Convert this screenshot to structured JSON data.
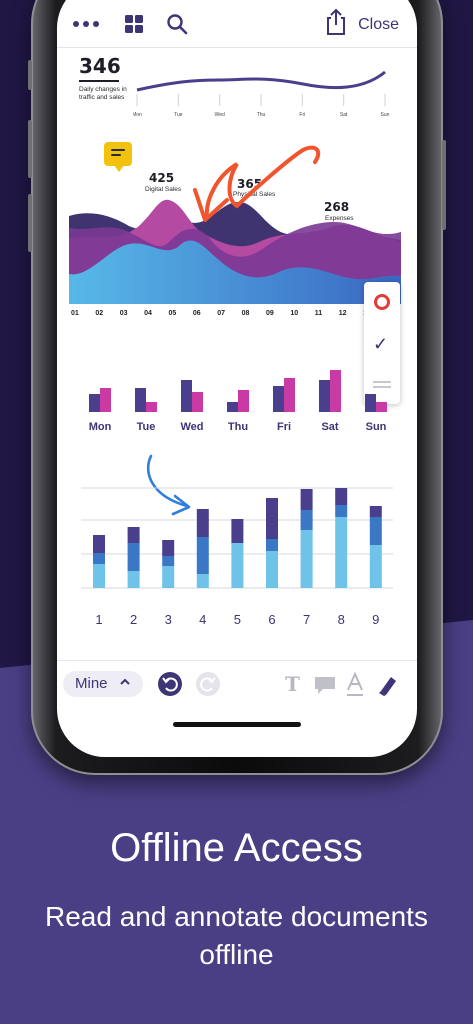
{
  "app": {
    "close_label": "Close",
    "icons": [
      "more-dots-icon",
      "grid-view-icon",
      "search-icon",
      "share-icon",
      "note-icon",
      "undo-icon",
      "redo-icon",
      "text-tool-icon",
      "comment-tool-icon",
      "text-style-icon",
      "pen-tool-icon",
      "checkmark-icon"
    ]
  },
  "document": {
    "line_chart": {
      "stat_value": "346",
      "stat_caption": "Daily changes in traffic and sales",
      "days": [
        "Mon",
        "Tue",
        "Wed",
        "Thu",
        "Fri",
        "Sat",
        "Sun"
      ],
      "values": [
        0.2,
        0.4,
        0.55,
        0.55,
        0.55,
        0.4,
        0.6
      ]
    },
    "area_chart": {
      "labels": [
        {
          "value": "425",
          "caption": "Digital Sales"
        },
        {
          "value": "365",
          "caption": "Physical Sales"
        },
        {
          "value": "268",
          "caption": "Expenses"
        }
      ],
      "x_ticks": [
        "01",
        "02",
        "03",
        "04",
        "05",
        "06",
        "07",
        "08",
        "09",
        "10",
        "11",
        "12",
        "13"
      ]
    },
    "paired_bar_chart": {
      "categories": [
        "Mon",
        "Tue",
        "Wed",
        "Thu",
        "Fri",
        "Sat",
        "Sun"
      ],
      "series": [
        {
          "color": "#4a3f8c",
          "values": [
            18,
            24,
            32,
            10,
            26,
            32,
            18
          ]
        },
        {
          "color": "#c93aa5",
          "values": [
            24,
            10,
            20,
            22,
            34,
            42,
            10
          ]
        }
      ]
    },
    "stacked_bar_chart": {
      "categories": [
        "1",
        "2",
        "3",
        "4",
        "5",
        "6",
        "7",
        "8",
        "9"
      ],
      "series": [
        {
          "color": "#6fc3e8",
          "values": [
            24,
            17,
            22,
            14,
            45,
            37,
            58,
            71,
            43
          ]
        },
        {
          "color": "#3a78c6",
          "values": [
            11,
            28,
            10,
            37,
            0,
            12,
            20,
            12,
            28
          ]
        },
        {
          "color": "#4a3f8c",
          "values": [
            18,
            16,
            16,
            28,
            24,
            41,
            21,
            17,
            11
          ]
        }
      ]
    }
  },
  "toolbar": {
    "filter_label": "Mine",
    "filter_chevron": "^"
  },
  "promo": {
    "headline": "Offline Access",
    "subline": "Read and annotate documents offline"
  },
  "colors": {
    "brand": "#3d3576",
    "annotation_red": "#f0552d",
    "annotation_blue": "#2f7ddc",
    "note_yellow": "#f2c20e"
  }
}
